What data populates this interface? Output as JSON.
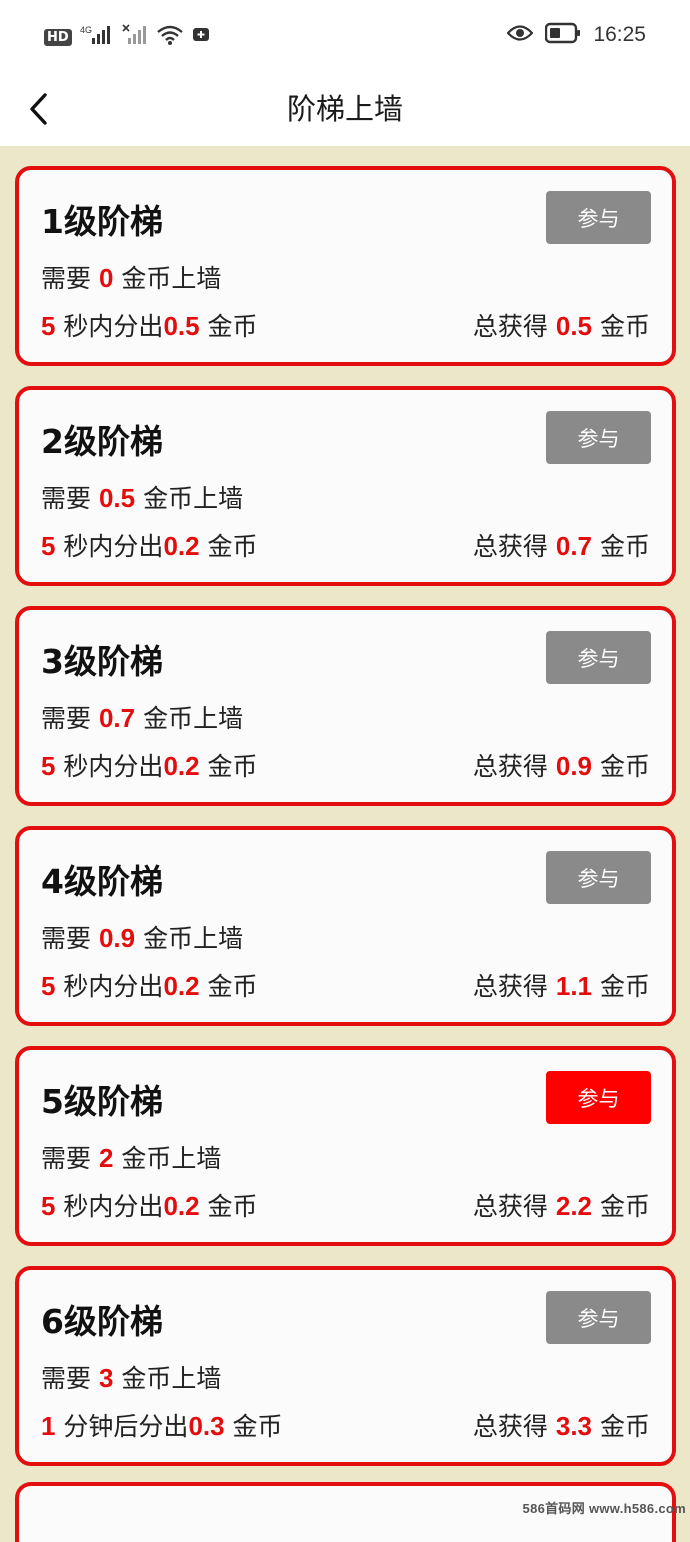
{
  "status_bar": {
    "hd_label": "HD",
    "network_label": "4G",
    "time": "16:25"
  },
  "header": {
    "title": "阶梯上墙"
  },
  "common": {
    "need_prefix": "需要",
    "need_suffix": "金币上墙",
    "payout_suffix": "金币",
    "total_prefix": "总获得",
    "total_suffix": "金币",
    "join_label": "参与"
  },
  "tiers": [
    {
      "title": "1级阶梯",
      "need": "0",
      "payout_num": "5",
      "payout_text": "秒内分出",
      "payout_amount": "0.5",
      "total": "0.5",
      "active": false
    },
    {
      "title": "2级阶梯",
      "need": "0.5",
      "payout_num": "5",
      "payout_text": "秒内分出",
      "payout_amount": "0.2",
      "total": "0.7",
      "active": false
    },
    {
      "title": "3级阶梯",
      "need": "0.7",
      "payout_num": "5",
      "payout_text": "秒内分出",
      "payout_amount": "0.2",
      "total": "0.9",
      "active": false
    },
    {
      "title": "4级阶梯",
      "need": "0.9",
      "payout_num": "5",
      "payout_text": "秒内分出",
      "payout_amount": "0.2",
      "total": "1.1",
      "active": false
    },
    {
      "title": "5级阶梯",
      "need": "2",
      "payout_num": "5",
      "payout_text": "秒内分出",
      "payout_amount": "0.2",
      "total": "2.2",
      "active": true
    },
    {
      "title": "6级阶梯",
      "need": "3",
      "payout_num": "1",
      "payout_text": "分钟后分出",
      "payout_amount": "0.3",
      "total": "3.3",
      "active": false
    }
  ],
  "colors": {
    "accent_red": "#e40d0d",
    "card_border": "#e30f0f",
    "button_gray": "#8a8a8a",
    "button_active": "#ff0000",
    "page_background": "#ece7c9"
  },
  "watermark": "586首码网 www.h586.com"
}
